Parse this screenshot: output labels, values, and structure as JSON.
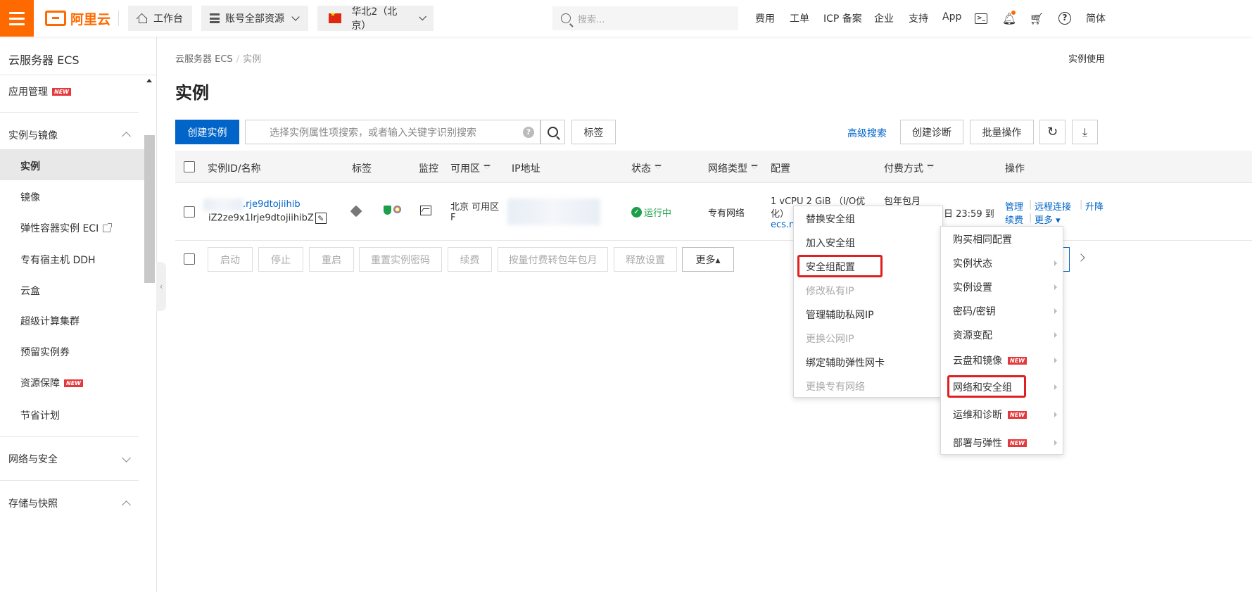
{
  "topbar": {
    "logo_text": "阿里云",
    "workbench": "工作台",
    "resources": "账号全部资源",
    "region": "华北2（北京）",
    "search_placeholder": "搜索...",
    "links": [
      "费用",
      "工单",
      "ICP 备案",
      "企业",
      "支持",
      "App"
    ],
    "lang": "简体"
  },
  "sidebar": {
    "title": "云服务器 ECS",
    "items": {
      "app_mgmt": "应用管理",
      "instance_image": "实例与镜像",
      "instance": "实例",
      "image": "镜像",
      "eci": "弹性容器实例 ECI",
      "ddh": "专有宿主机 DDH",
      "cloudbox": "云盒",
      "scc": "超级计算集群",
      "reserved": "预留实例券",
      "assurance": "资源保障",
      "savings": "节省计划",
      "network": "网络与安全",
      "storage": "存储与快照"
    },
    "new_badge": "NEW"
  },
  "main": {
    "breadcrumb": [
      "云服务器 ECS",
      "/",
      "实例"
    ],
    "top_right": "实例使用",
    "title": "实例",
    "create_btn": "创建实例",
    "search_placeholder": "选择实例属性项搜索，或者输入关键字识别搜索",
    "tag_btn": "标签",
    "advanced_search": "高级搜索",
    "create_diag": "创建诊断",
    "batch_ops": "批量操作"
  },
  "table": {
    "headers": {
      "id": "实例ID/名称",
      "tag": "标签",
      "monitor": "监控",
      "zone": "可用区",
      "ip": "IP地址",
      "status": "状态",
      "nettype": "网络类型",
      "config": "配置",
      "billing": "付费方式",
      "ops": "操作"
    },
    "row": {
      "id_suffix": ".rje9dtojiihib",
      "name": "iZ2ze9x1lrje9dtojiihibZ",
      "zone_line1": "北京 可用区",
      "zone_line2": "F",
      "status": "运行中",
      "nettype": "专有网络",
      "config_line1": "1 vCPU 2 GiB （I/O优",
      "config_line2": "化）",
      "config_line3": "ecs.n4",
      "billing": "包年包月",
      "expire": "日 23:59 到",
      "op_manage": "管理",
      "op_remote": "远程连接",
      "op_upgrade": "升降",
      "op_renew": "续费",
      "op_more": "更多"
    }
  },
  "batch": [
    "启动",
    "停止",
    "重启",
    "重置实例密码",
    "续费",
    "按量付费转包年包月",
    "释放设置",
    "更多▴"
  ],
  "submenu_left": [
    {
      "label": "替换安全组",
      "disabled": false
    },
    {
      "label": "加入安全组",
      "disabled": false
    },
    {
      "label": "安全组配置",
      "disabled": false
    },
    {
      "label": "修改私有IP",
      "disabled": true
    },
    {
      "label": "管理辅助私网IP",
      "disabled": false
    },
    {
      "label": "更换公网IP",
      "disabled": true
    },
    {
      "label": "绑定辅助弹性网卡",
      "disabled": false
    },
    {
      "label": "更换专有网络",
      "disabled": true
    }
  ],
  "submenu_right": [
    {
      "label": "购买相同配置",
      "arrow": false,
      "new": false
    },
    {
      "label": "实例状态",
      "arrow": true,
      "new": false
    },
    {
      "label": "实例设置",
      "arrow": true,
      "new": false
    },
    {
      "label": "密码/密钥",
      "arrow": true,
      "new": false
    },
    {
      "label": "资源变配",
      "arrow": true,
      "new": false
    },
    {
      "label": "云盘和镜像",
      "arrow": true,
      "new": true
    },
    {
      "label": "网络和安全组",
      "arrow": true,
      "new": false
    },
    {
      "label": "运维和诊断",
      "arrow": true,
      "new": true
    },
    {
      "label": "部署与弹性",
      "arrow": true,
      "new": true
    }
  ],
  "colors": {
    "brand": "#ff6a00",
    "primary": "#0064c8",
    "highlight": "#e02020",
    "success": "#1e9e4a"
  }
}
